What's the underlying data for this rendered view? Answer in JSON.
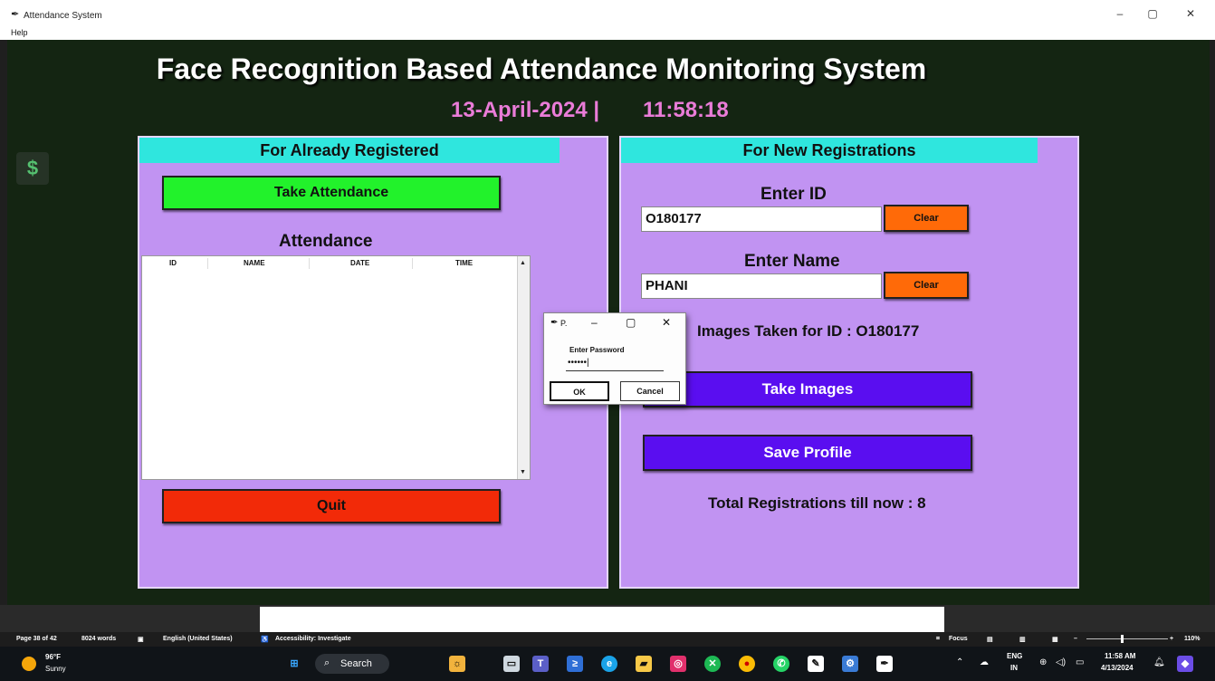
{
  "window": {
    "title": "Attendance System",
    "menu": [
      "Help"
    ],
    "controls": [
      "–",
      "▢",
      "✕"
    ]
  },
  "app": {
    "title": "Face Recognition Based Attendance Monitoring System",
    "date": "13-April-2024  |",
    "time": "11:58:18"
  },
  "left_frame": {
    "header": "For Already Registered",
    "take_attendance": "Take Attendance",
    "attendance_label": "Attendance",
    "columns": [
      "ID",
      "NAME",
      "DATE",
      "TIME"
    ],
    "quit": "Quit"
  },
  "right_frame": {
    "header": "For New Registrations",
    "enter_id_label": "Enter ID",
    "id_value": "O180177",
    "clear1": "Clear",
    "enter_name_label": "Enter Name",
    "name_value": "PHANI",
    "clear2": "Clear",
    "images_message": "Images Taken for ID : O180177",
    "take_images": "Take Images",
    "save_profile": "Save Profile",
    "total_registrations": "Total Registrations till now  : 8"
  },
  "dialog": {
    "title": "P.",
    "label": "Enter Password",
    "value": "••••••|",
    "ok": "OK",
    "cancel": "Cancel"
  },
  "statusbar": {
    "page": "Page 38 of 42",
    "words": "8024 words",
    "language": "English (United States)",
    "accessibility": "Accessibility: Investigate",
    "focus": "Focus",
    "zoom": "110%"
  },
  "taskbar": {
    "weather_temp": "96°F",
    "weather_desc": "Sunny",
    "search": "Search",
    "lang1": "ENG",
    "lang2": "IN",
    "clock_time": "11:58 AM",
    "clock_date": "4/13/2024"
  },
  "colors": {
    "background": "#142512",
    "frame": "#c193f2",
    "header": "#2fe6de",
    "green_button": "#22f22b",
    "red_button": "#f22a08",
    "orange_button": "#ff6a08",
    "blue_button": "#5a0ef0",
    "date_text": "#ea7cd8"
  }
}
